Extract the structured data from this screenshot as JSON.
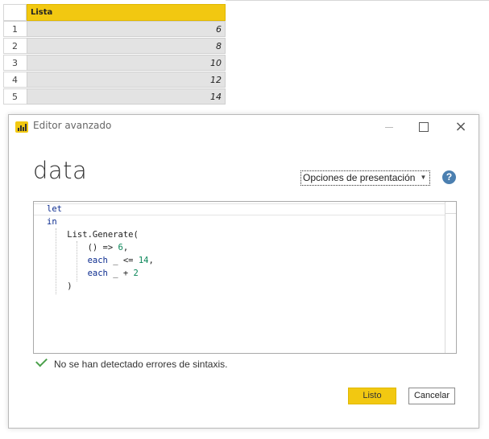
{
  "table": {
    "column_header": "Lista",
    "rows": [
      {
        "index": "1",
        "value": "6"
      },
      {
        "index": "2",
        "value": "8"
      },
      {
        "index": "3",
        "value": "10"
      },
      {
        "index": "4",
        "value": "12"
      },
      {
        "index": "5",
        "value": "14"
      }
    ]
  },
  "dialog": {
    "title": "Editor avanzado",
    "query_name": "data",
    "display_options_label": "Opciones de presentación",
    "help_glyph": "?",
    "close_glyph": "×",
    "code_lines": [
      [
        {
          "t": "let",
          "c": "kw"
        }
      ],
      [
        {
          "t": "in",
          "c": "kw"
        }
      ],
      [
        {
          "t": "    List.Generate(",
          "c": ""
        }
      ],
      [
        {
          "t": "        () => ",
          "c": ""
        },
        {
          "t": "6",
          "c": "num"
        },
        {
          "t": ",",
          "c": ""
        }
      ],
      [
        {
          "t": "        ",
          "c": ""
        },
        {
          "t": "each",
          "c": "kw"
        },
        {
          "t": " _ <= ",
          "c": ""
        },
        {
          "t": "14",
          "c": "num"
        },
        {
          "t": ",",
          "c": ""
        }
      ],
      [
        {
          "t": "        ",
          "c": ""
        },
        {
          "t": "each",
          "c": "kw"
        },
        {
          "t": " _ + ",
          "c": ""
        },
        {
          "t": "2",
          "c": "num"
        }
      ],
      [
        {
          "t": "    )",
          "c": ""
        }
      ]
    ],
    "status_text": "No se han detectado errores de sintaxis.",
    "ok_label": "Listo",
    "cancel_label": "Cancelar"
  },
  "colors": {
    "accent": "#f2c811",
    "keyword": "#0b2b8f",
    "number": "#098658",
    "success": "#4aa04a"
  },
  "icons": [
    "power-bi-app-icon",
    "minimize-icon",
    "maximize-icon",
    "close-icon",
    "help-icon",
    "check-icon",
    "dropdown-caret-icon"
  ]
}
